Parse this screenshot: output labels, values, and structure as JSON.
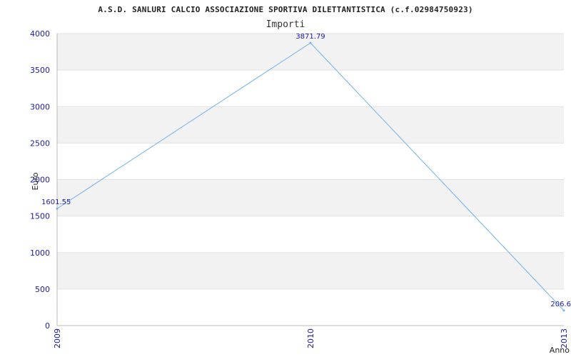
{
  "chart_data": {
    "type": "line",
    "title": "A.S.D. SANLURI CALCIO ASSOCIAZIONE SPORTIVA DILETTANTISTICA (c.f.02984750923)",
    "subtitle": "Importi",
    "xlabel": "Anno",
    "ylabel": "Euro",
    "categories": [
      "2009",
      "2010",
      "2013"
    ],
    "series": [
      {
        "values": [
          1601.55,
          3871.79,
          206.6
        ]
      }
    ],
    "data_labels": [
      "1601.55",
      "3871.79",
      "206.6"
    ],
    "yticks": [
      0,
      500,
      1000,
      1500,
      2000,
      2500,
      3000,
      3500,
      4000
    ],
    "ylim": [
      0,
      4000
    ],
    "grid": true,
    "colors": {
      "line": "#6fb0ef",
      "band": "#f2f2f2",
      "grid": "#e2e2e2",
      "axis": "#bbbbbb",
      "tick_text": "#1a1aa6"
    }
  }
}
